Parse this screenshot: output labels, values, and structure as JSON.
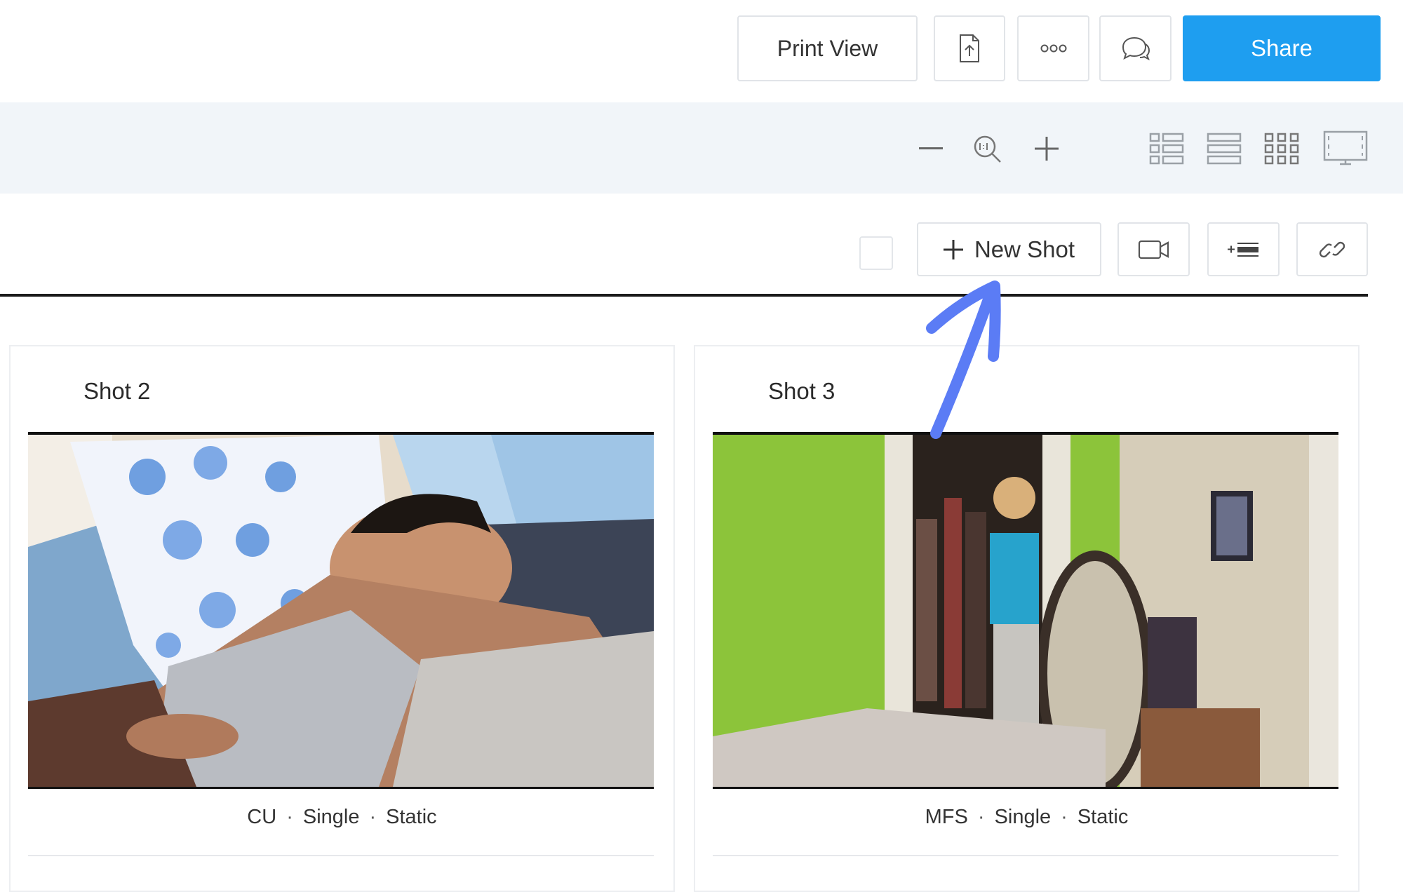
{
  "toolbar": {
    "print_view_label": "Print View",
    "share_label": "Share",
    "share_color": "#1e9ef0",
    "icons": [
      "export-icon",
      "more-icon",
      "comments-icon"
    ]
  },
  "view_bar": {
    "icons": [
      "zoom-out-icon",
      "zoom-reset-icon",
      "zoom-in-icon",
      "list-view-icon",
      "rows-view-icon",
      "grid-view-icon",
      "presentation-view-icon"
    ]
  },
  "actions": {
    "new_shot_label": "New Shot",
    "icons": [
      "select-all-checkbox",
      "video-icon",
      "insert-break-icon",
      "link-icon"
    ]
  },
  "shots": [
    {
      "title": "Shot 2",
      "tags": [
        "CU",
        "Single",
        "Static"
      ]
    },
    {
      "title": "Shot 3",
      "tags": [
        "MFS",
        "Single",
        "Static"
      ]
    }
  ],
  "annotation": {
    "arrow_color": "#5b7cf5"
  }
}
